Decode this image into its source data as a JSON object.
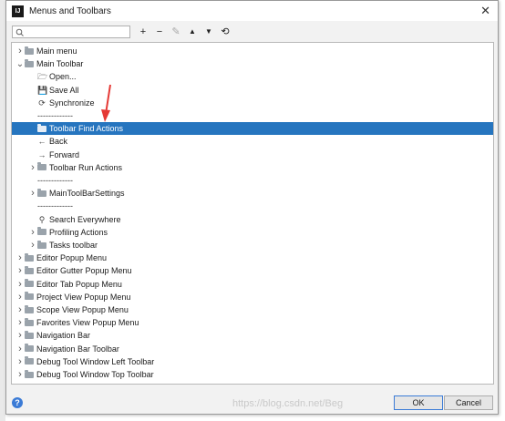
{
  "window": {
    "title": "Menus and Toolbars",
    "app_icon": "IJ"
  },
  "search": {
    "placeholder": ""
  },
  "toolbar": {
    "add": "+",
    "remove": "−",
    "edit": "✎",
    "up": "▲",
    "down": "▼",
    "restore": "⟲"
  },
  "tree": {
    "rows": [
      {
        "label": "Main menu",
        "level": 0,
        "expand": "collapsed",
        "icon": "folder"
      },
      {
        "label": "Main Toolbar",
        "level": 0,
        "expand": "expanded",
        "icon": "folder"
      },
      {
        "label": "Open...",
        "level": 1,
        "expand": "none",
        "icon": "open"
      },
      {
        "label": "Save All",
        "level": 1,
        "expand": "none",
        "icon": "save"
      },
      {
        "label": "Synchronize",
        "level": 1,
        "expand": "none",
        "icon": "sync"
      },
      {
        "label": "-------------",
        "level": 1,
        "expand": "none",
        "icon": "none"
      },
      {
        "label": "Toolbar Find Actions",
        "level": 1,
        "expand": "none",
        "icon": "folder",
        "selected": true
      },
      {
        "label": "Back",
        "level": 1,
        "expand": "none",
        "icon": "back"
      },
      {
        "label": "Forward",
        "level": 1,
        "expand": "none",
        "icon": "forward"
      },
      {
        "label": "Toolbar Run Actions",
        "level": 1,
        "expand": "collapsed",
        "icon": "folder"
      },
      {
        "label": "-------------",
        "level": 1,
        "expand": "none",
        "icon": "none"
      },
      {
        "label": "MainToolBarSettings",
        "level": 1,
        "expand": "collapsed",
        "icon": "folder"
      },
      {
        "label": "-------------",
        "level": 1,
        "expand": "none",
        "icon": "none"
      },
      {
        "label": "Search Everywhere",
        "level": 1,
        "expand": "none",
        "icon": "search"
      },
      {
        "label": "Profiling Actions",
        "level": 1,
        "expand": "collapsed",
        "icon": "folder"
      },
      {
        "label": "Tasks toolbar",
        "level": 1,
        "expand": "collapsed",
        "icon": "folder"
      },
      {
        "label": "Editor Popup Menu",
        "level": 0,
        "expand": "collapsed",
        "icon": "folder"
      },
      {
        "label": "Editor Gutter Popup Menu",
        "level": 0,
        "expand": "collapsed",
        "icon": "folder"
      },
      {
        "label": "Editor Tab Popup Menu",
        "level": 0,
        "expand": "collapsed",
        "icon": "folder"
      },
      {
        "label": "Project View Popup Menu",
        "level": 0,
        "expand": "collapsed",
        "icon": "folder"
      },
      {
        "label": "Scope View Popup Menu",
        "level": 0,
        "expand": "collapsed",
        "icon": "folder"
      },
      {
        "label": "Favorites View Popup Menu",
        "level": 0,
        "expand": "collapsed",
        "icon": "folder"
      },
      {
        "label": "Navigation Bar",
        "level": 0,
        "expand": "collapsed",
        "icon": "folder"
      },
      {
        "label": "Navigation Bar Toolbar",
        "level": 0,
        "expand": "collapsed",
        "icon": "folder"
      },
      {
        "label": "Debug Tool Window Left Toolbar",
        "level": 0,
        "expand": "collapsed",
        "icon": "folder"
      },
      {
        "label": "Debug Tool Window Top Toolbar",
        "level": 0,
        "expand": "collapsed",
        "icon": "folder"
      }
    ]
  },
  "footer": {
    "help": "?",
    "ok_label": "OK",
    "cancel_label": "Cancel"
  },
  "watermark": "https://blog.csdn.net/Beg",
  "colors": {
    "selection": "#2675bf",
    "annotation_arrow": "#e53935"
  }
}
